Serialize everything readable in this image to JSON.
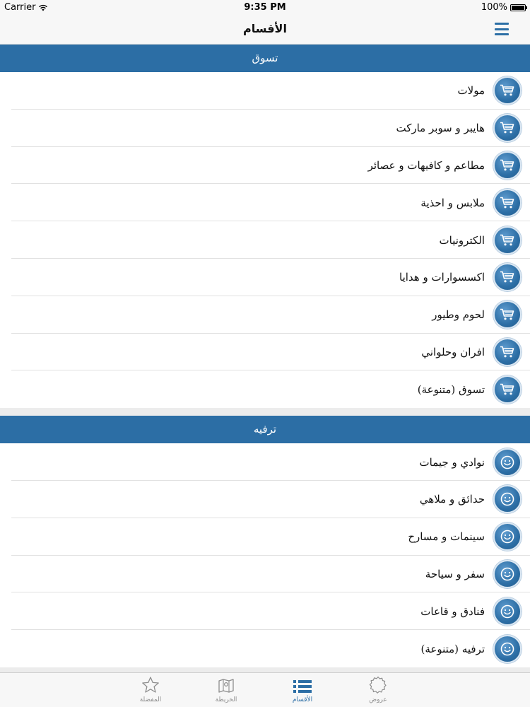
{
  "status_bar": {
    "carrier": "Carrier",
    "time": "9:35 PM",
    "battery": "100%"
  },
  "nav": {
    "title": "الأقسام",
    "menu_icon": "hamburger-icon"
  },
  "sections": [
    {
      "title": "تسوق",
      "icon": "cart-icon",
      "items": [
        "مولات",
        "هايبر و سوبر ماركت",
        "مطاعم و كافيهات و عصائر",
        "ملابس و احذية",
        "الكترونيات",
        "اكسسوارات و هدايا",
        "لحوم وطيور",
        "افران وحلواني",
        "تسوق (متنوعة)"
      ]
    },
    {
      "title": "ترفيه",
      "icon": "smiley-icon",
      "items": [
        "نوادي و جيمات",
        "حدائق و ملاهي",
        "سينمات و مسارح",
        "سفر و سياحة",
        "فنادق و قاعات",
        "ترفيه (متنوعة)"
      ]
    }
  ],
  "tabs": [
    {
      "label": "المفضلة",
      "icon": "star-icon",
      "active": false
    },
    {
      "label": "الخريطة",
      "icon": "map-icon",
      "active": false
    },
    {
      "label": "الأقسام",
      "icon": "list-icon",
      "active": true
    },
    {
      "label": "عروض",
      "icon": "badge-icon",
      "active": false
    }
  ],
  "colors": {
    "accent": "#2c6ea5",
    "tab_inactive": "#8d8d8d"
  }
}
